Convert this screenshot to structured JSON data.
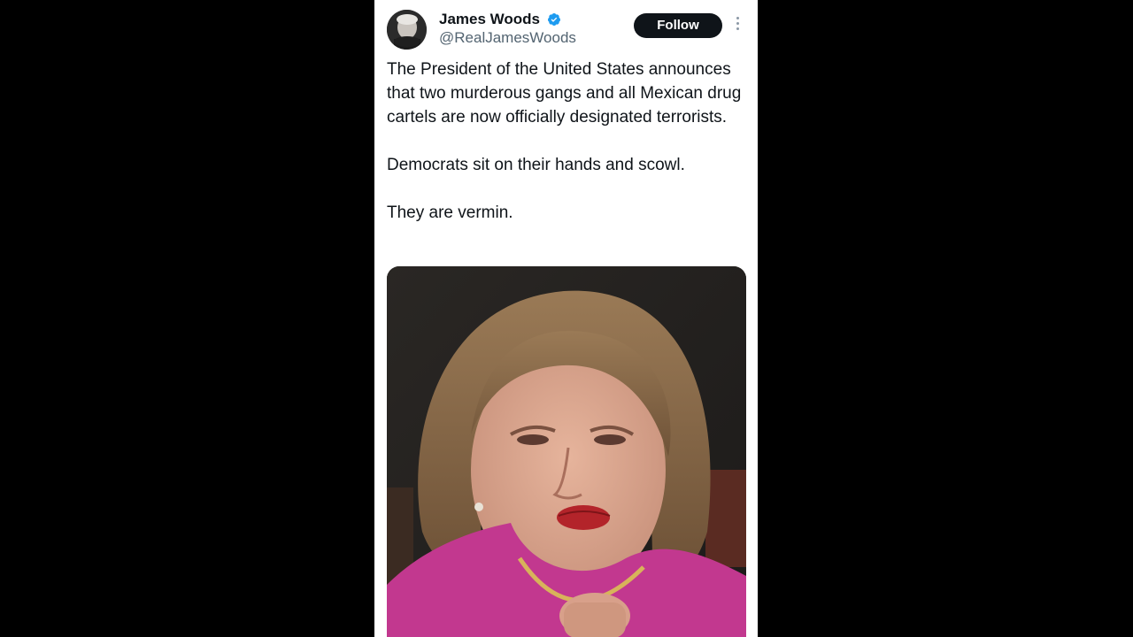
{
  "tweet": {
    "author": {
      "display_name": "James Woods",
      "handle": "@RealJamesWoods",
      "verified": true,
      "verified_color": "#1d9bf0",
      "avatar_icon": "profile-photo"
    },
    "follow_label": "Follow",
    "more_icon": "more-vertical-icon",
    "paragraphs": [
      "The President of the United States announces that two murderous gangs and all Mexican drug cartels are now officially designated terrorists.",
      "Democrats sit on their hands and scowl.",
      "They are vermin."
    ],
    "media": {
      "type": "photo"
    }
  },
  "colors": {
    "page_background": "#000000",
    "card_background": "#ffffff",
    "text_primary": "#0f1419",
    "text_secondary": "#536471",
    "button_dark": "#0f1419"
  }
}
